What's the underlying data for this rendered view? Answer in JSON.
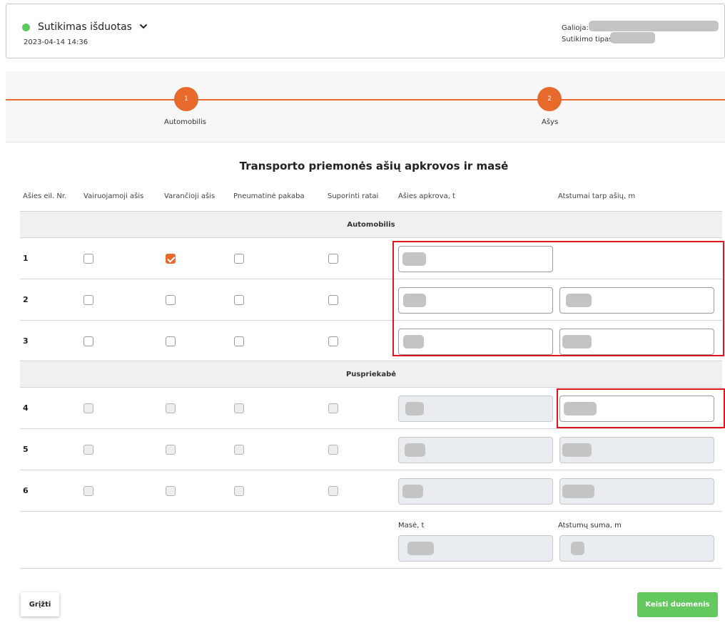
{
  "status": {
    "title": "Sutikimas išduotas",
    "date": "2023-04-14 14:36",
    "valid_label": "Galioja:",
    "type_label": "Sutikimo tipas:",
    "dot_color": "#5cc95c"
  },
  "stepper": {
    "steps": [
      {
        "number": "1",
        "label": "Automobilis"
      },
      {
        "number": "2",
        "label": "Ašys"
      }
    ],
    "accent": "#e8692c"
  },
  "section_title": "Transporto priemonės ašių apkrovos ir masė",
  "columns": [
    "Ašies eil. Nr.",
    "Vairuojamoji ašis",
    "Varančioji ašis",
    "Pneumatinė pakaba",
    "Suporinti ratai",
    "Ašies apkrova, t",
    "Atstumai tarp ašių, m"
  ],
  "groups": [
    {
      "name": "Automobilis",
      "rows": [
        {
          "no": "1",
          "steering": false,
          "driving": true,
          "pneumatic": false,
          "twin": false
        },
        {
          "no": "2",
          "steering": false,
          "driving": false,
          "pneumatic": false,
          "twin": false
        },
        {
          "no": "3",
          "steering": false,
          "driving": false,
          "pneumatic": false,
          "twin": false
        }
      ]
    },
    {
      "name": "Puspriekabė",
      "rows": [
        {
          "no": "4",
          "steering": false,
          "driving": false,
          "pneumatic": false,
          "twin": false
        },
        {
          "no": "5",
          "steering": false,
          "driving": false,
          "pneumatic": false,
          "twin": false
        },
        {
          "no": "6",
          "steering": false,
          "driving": false,
          "pneumatic": false,
          "twin": false
        }
      ]
    }
  ],
  "summary": {
    "mass_label": "Masė, t",
    "distance_sum_label": "Atstumų suma, m"
  },
  "buttons": {
    "back": "Grįžti",
    "save": "Keisti duomenis"
  },
  "colors": {
    "checkbox_checked": "#e8692c",
    "save_button": "#63c95f",
    "highlight": "#e0141e"
  }
}
